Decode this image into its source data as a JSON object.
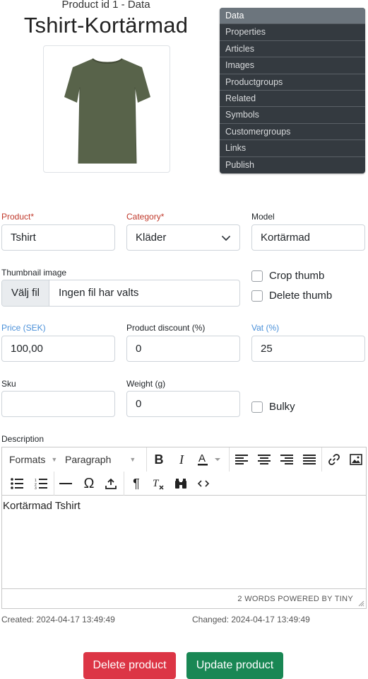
{
  "header": {
    "subtitle": "Product id 1 - Data",
    "title": "Tshirt-Kortärmad"
  },
  "nav": {
    "items": [
      {
        "label": "Data",
        "active": true
      },
      {
        "label": "Properties"
      },
      {
        "label": "Articles"
      },
      {
        "label": "Images"
      },
      {
        "label": "Productgroups"
      },
      {
        "label": "Related"
      },
      {
        "label": "Symbols"
      },
      {
        "label": "Customergroups"
      },
      {
        "label": "Links"
      },
      {
        "label": "Publish"
      }
    ]
  },
  "form": {
    "product": {
      "label": "Product*",
      "value": "Tshirt"
    },
    "category": {
      "label": "Category*",
      "value": "Kläder"
    },
    "model": {
      "label": "Model",
      "value": "Kortärmad"
    },
    "thumbnail": {
      "label": "Thumbnail image",
      "button": "Välj fil",
      "text": "Ingen fil har valts"
    },
    "crop_thumb": {
      "label": "Crop thumb",
      "checked": false
    },
    "delete_thumb": {
      "label": "Delete thumb",
      "checked": false
    },
    "price": {
      "label": "Price (SEK)",
      "value": "100,00"
    },
    "discount": {
      "label": "Product discount (%)",
      "value": "0"
    },
    "vat": {
      "label": "Vat (%)",
      "value": "25"
    },
    "sku": {
      "label": "Sku",
      "value": ""
    },
    "weight": {
      "label": "Weight (g)",
      "value": "0"
    },
    "bulky": {
      "label": "Bulky",
      "checked": false
    },
    "description": {
      "label": "Description"
    }
  },
  "editor": {
    "formats": "Formats",
    "paragraph": "Paragraph",
    "content": "Kortärmad Tshirt",
    "status": "2 WORDS POWERED BY TINY"
  },
  "meta": {
    "created": "Created: 2024-04-17 13:49:49",
    "changed": "Changed: 2024-04-17 13:49:49"
  },
  "actions": {
    "delete": "Delete product",
    "update": "Update product"
  },
  "colors": {
    "nav_bg": "#343a40",
    "nav_active": "#6c757d",
    "required_label": "#c0392b",
    "blue_label": "#4a90d9",
    "danger": "#dc3545",
    "success": "#198754",
    "shirt": "#58634a"
  }
}
